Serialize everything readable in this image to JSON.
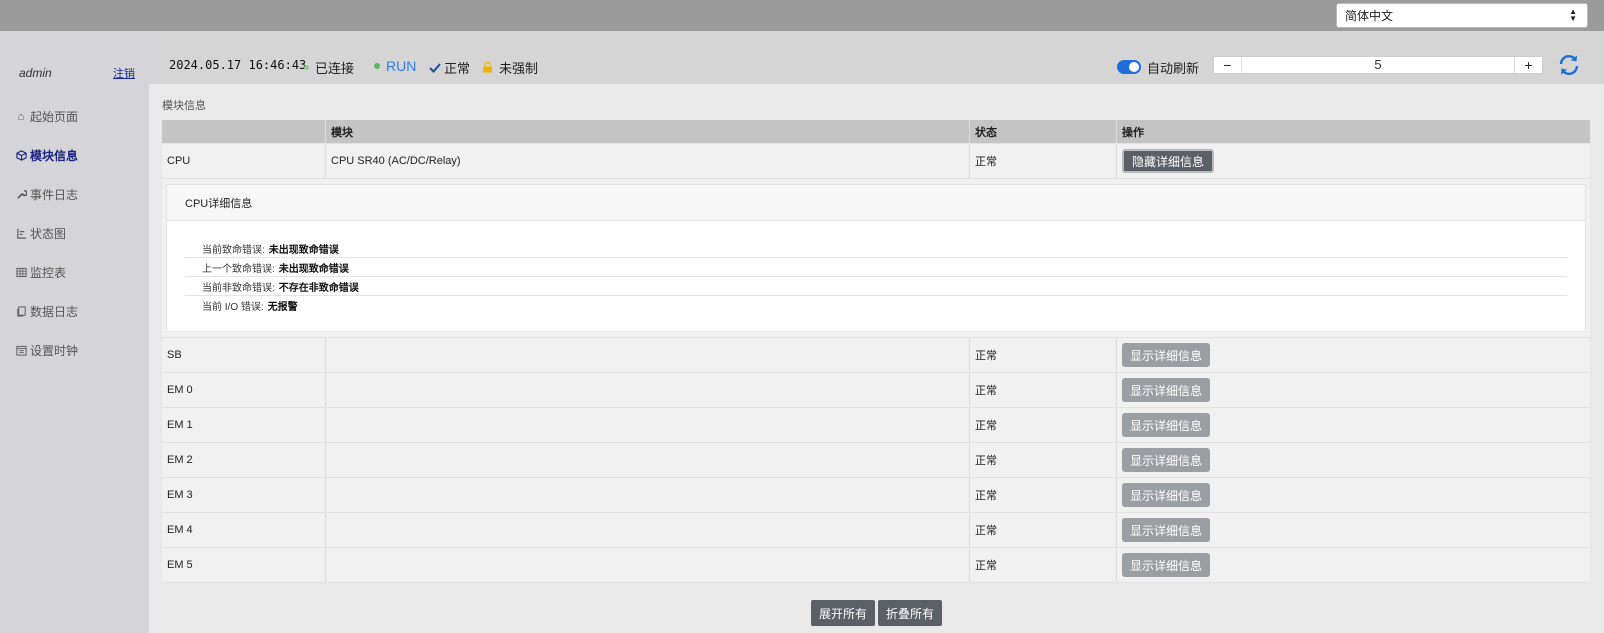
{
  "language": {
    "selected": "简体中文"
  },
  "user": {
    "name": "admin",
    "logout_label": "注销"
  },
  "nav": [
    {
      "label": "起始页面",
      "icon": "home-icon",
      "glyph": "⌂"
    },
    {
      "label": "模块信息",
      "icon": "cube-icon",
      "glyph": "⬡",
      "active": true
    },
    {
      "label": "事件日志",
      "icon": "wrench-icon",
      "glyph": "🔧"
    },
    {
      "label": "状态图",
      "icon": "tree-icon",
      "glyph": "⊩"
    },
    {
      "label": "监控表",
      "icon": "table-icon",
      "glyph": "▦"
    },
    {
      "label": "数据日志",
      "icon": "copy-icon",
      "glyph": "❐"
    },
    {
      "label": "设置时钟",
      "icon": "calendar-icon",
      "glyph": "▤"
    }
  ],
  "status": {
    "datetime": "2024.05.17 16:46:43",
    "connected": "已连接",
    "run": "RUN",
    "normal": "正常",
    "not_forced": "未强制",
    "auto_refresh_label": "自动刷新",
    "refresh_interval": "5",
    "colors": {
      "connected_dot": "#8ec98e",
      "run_dot": "#5cb85c",
      "check": "#1a4fa0",
      "lock": "#f0b400",
      "accent": "#1e6fd9"
    }
  },
  "page_title": "模块信息",
  "table": {
    "headers": [
      "",
      "模块",
      "状态",
      "操作"
    ],
    "rows": [
      {
        "name": "CPU",
        "module": "CPU SR40 (AC/DC/Relay)",
        "status": "正常",
        "action": "隐藏详细信息",
        "expanded": true
      },
      {
        "name": "SB",
        "module": "",
        "status": "正常",
        "action": "显示详细信息"
      },
      {
        "name": "EM 0",
        "module": "",
        "status": "正常",
        "action": "显示详细信息"
      },
      {
        "name": "EM 1",
        "module": "",
        "status": "正常",
        "action": "显示详细信息"
      },
      {
        "name": "EM 2",
        "module": "",
        "status": "正常",
        "action": "显示详细信息"
      },
      {
        "name": "EM 3",
        "module": "",
        "status": "正常",
        "action": "显示详细信息"
      },
      {
        "name": "EM 4",
        "module": "",
        "status": "正常",
        "action": "显示详细信息"
      },
      {
        "name": "EM 5",
        "module": "",
        "status": "正常",
        "action": "显示详细信息"
      }
    ]
  },
  "cpu_detail": {
    "title": "CPU详细信息",
    "lines": [
      {
        "label": "当前致命错误:",
        "value": "未出现致命错误"
      },
      {
        "label": "上一个致命错误:",
        "value": "未出现致命错误"
      },
      {
        "label": "当前非致命错误:",
        "value": "不存在非致命错误"
      },
      {
        "label": "当前 I/O 错误:",
        "value": "无报警"
      }
    ]
  },
  "bottom": {
    "expand_all": "展开所有",
    "collapse_all": "折叠所有"
  }
}
